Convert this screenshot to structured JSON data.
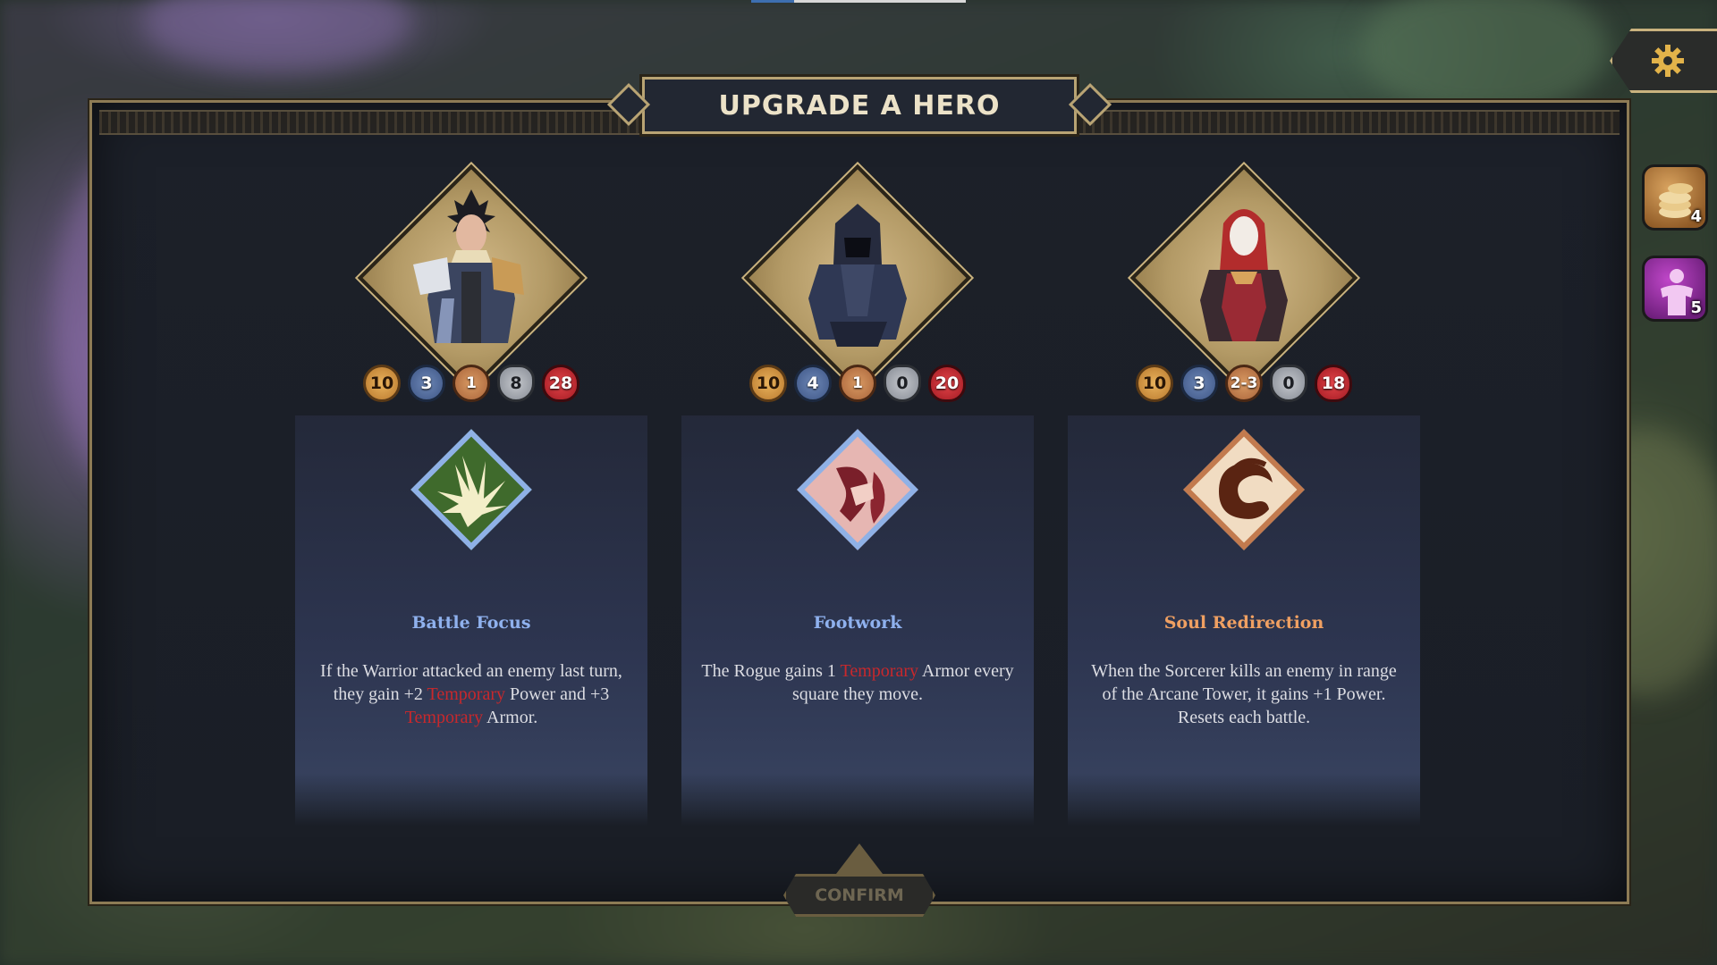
{
  "title": "UPGRADE A HERO",
  "confirm_label": "CONFIRM",
  "side_buttons": {
    "gold_count": "4",
    "purple_count": "5"
  },
  "heroes": [
    {
      "class": "Warrior",
      "stats": {
        "move": "10",
        "range": "3",
        "power": "1",
        "armor": "8",
        "health": "28"
      },
      "ability": {
        "name": "Battle Focus",
        "color": "#8fb1ee",
        "desc_parts": [
          "If the Warrior attacked an enemy last turn, they gain +2 ",
          "Temporary",
          " Power and +3 ",
          "Temporary",
          " Armor."
        ]
      }
    },
    {
      "class": "Rogue",
      "stats": {
        "move": "10",
        "range": "4",
        "power": "1",
        "armor": "0",
        "health": "20"
      },
      "ability": {
        "name": "Footwork",
        "color": "#8fb1ee",
        "desc_parts": [
          "The Rogue gains 1 ",
          "Temporary",
          " Armor every square they move."
        ]
      }
    },
    {
      "class": "Sorcerer",
      "stats": {
        "move": "10",
        "range": "3",
        "power": "2-3",
        "armor": "0",
        "health": "18"
      },
      "ability": {
        "name": "Soul Redirection",
        "color": "#f0a062",
        "desc_parts": [
          "When the Sorcerer kills an enemy in range of the Arcane Tower, it gains +1 Power. Resets each battle."
        ]
      }
    }
  ],
  "icons": {
    "settings": "gear-icon",
    "gold": "coin-stack-icon",
    "purple": "hero-silhouette-icon",
    "stat_move": "move-boot-icon",
    "stat_range": "range-icon",
    "stat_power": "power-icon",
    "stat_armor": "armor-shield-icon",
    "stat_health": "heart-icon"
  }
}
